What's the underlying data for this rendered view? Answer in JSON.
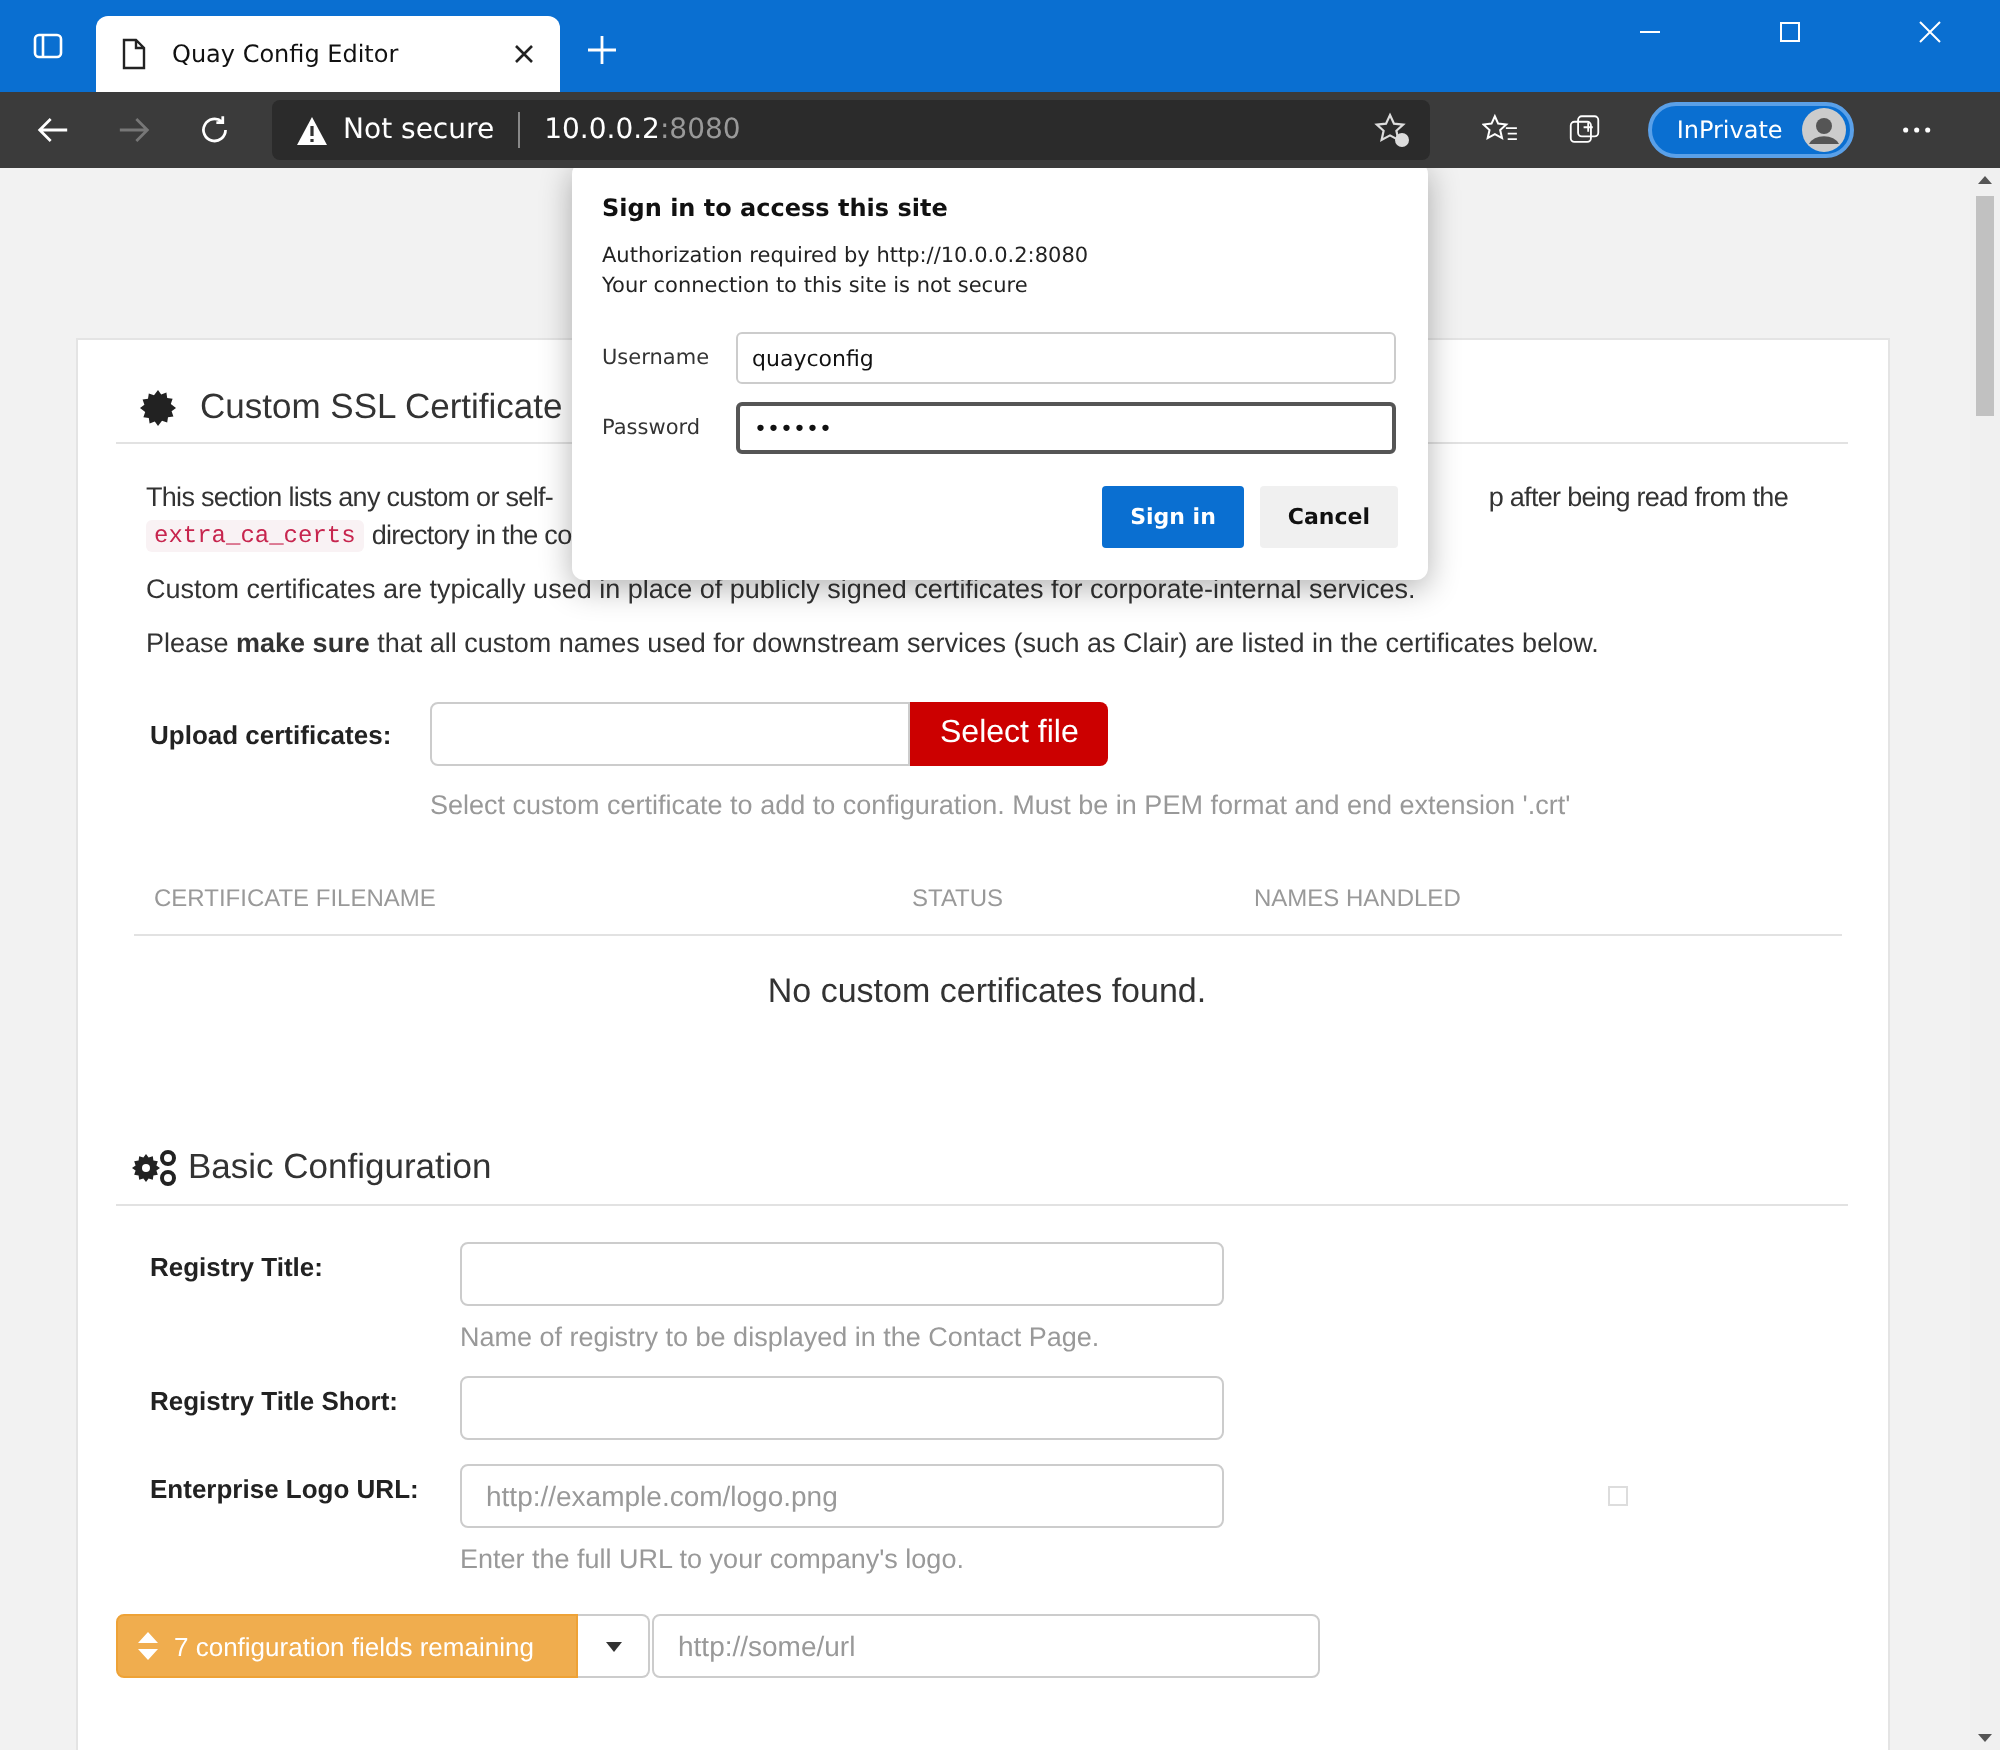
{
  "browser": {
    "tab_title": "Quay Config Editor",
    "security_label": "Not secure",
    "url_host": "10.0.0.2",
    "url_port": ":8080",
    "profile_label": "InPrivate"
  },
  "dialog": {
    "title": "Sign in to access this site",
    "lines": [
      "Authorization required by http://10.0.0.2:8080",
      "Your connection to this site is not secure"
    ],
    "fields": [
      {
        "label": "Username",
        "value": "quayconfig",
        "focused": false
      },
      {
        "label": "Password",
        "value": "••••••",
        "focused": true
      }
    ],
    "buttons": [
      {
        "label": "Sign in",
        "primary": true
      },
      {
        "label": "Cancel",
        "primary": false
      }
    ]
  },
  "ssl_section": {
    "title": "Custom SSL Certificate",
    "intro_left": "This section lists any custom or self-",
    "intro_right": "p after being read from the",
    "code": "extra_ca_certs",
    "code_after": "directory in the co",
    "paragraphs": [
      "Custom certificates are typically used in place of publicly signed certificates for corporate-internal services.",
      "Please **make sure** that all custom names used for downstream services (such as Clair) are listed in the certificates below."
    ],
    "upload": {
      "label": "Upload certificates:",
      "button": "Select file",
      "help": "Select custom certificate to add to configuration. Must be in PEM format and end extension '.crt'"
    },
    "table": {
      "columns": [
        "CERTIFICATE FILENAME",
        "STATUS",
        "NAMES HANDLED"
      ],
      "empty": "No custom certificates found."
    }
  },
  "basic_section": {
    "title": "Basic Configuration",
    "fields": [
      {
        "label": "Registry Title:",
        "help": "Name of registry to be displayed in the Contact Page."
      },
      {
        "label": "Registry Title Short:"
      },
      {
        "label": "Enterprise Logo URL:",
        "placeholder": "http://example.com/logo.png",
        "help": "Enter the full URL to your company's logo."
      }
    ]
  },
  "bottom": {
    "remaining": "7 configuration fields remaining",
    "placeholder": "http://some/url"
  }
}
